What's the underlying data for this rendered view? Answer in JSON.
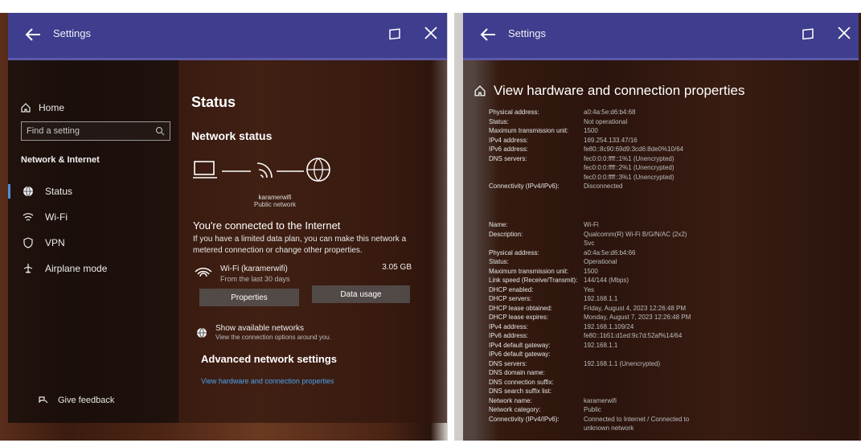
{
  "left": {
    "title": "Settings",
    "nav": {
      "home": "Home",
      "search_placeholder": "Find a setting",
      "section": "Network & Internet",
      "items": [
        {
          "label": "Status"
        },
        {
          "label": "Wi-Fi"
        },
        {
          "label": "VPN"
        },
        {
          "label": "Airplane mode"
        }
      ],
      "feedback": "Give feedback"
    },
    "content": {
      "title": "Status",
      "network_status": "Network status",
      "network_name": "karamerwifi",
      "network_type": "Public network",
      "connected": "You're connected to the Internet",
      "connected_desc": "If you have a limited data plan, you can make this network a metered connection or change other properties.",
      "wifi_name": "Wi-Fi (karamerwifi)",
      "wifi_sub": "From the last 30 days",
      "wifi_usage": "3.05 GB",
      "properties_btn": "Properties",
      "data_usage_btn": "Data usage",
      "show_networks": "Show available networks",
      "show_networks_desc": "View the connection options around you.",
      "advanced": "Advanced network settings",
      "advanced_link": "View hardware and connection properties"
    }
  },
  "right": {
    "title": "Settings",
    "header": "View hardware and connection properties",
    "group1": [
      {
        "k": "Physical address:",
        "v": "a0:4a:5e:d6:b4:68"
      },
      {
        "k": "Status:",
        "v": "Not operational"
      },
      {
        "k": "Maximum transmission unit:",
        "v": "1500"
      },
      {
        "k": "IPv4 address:",
        "v": "169.254.133.47/16"
      },
      {
        "k": "IPv6 address:",
        "v": "fe80::8c90:69d9:3cd6:8de0%10/64"
      },
      {
        "k": "DNS servers:",
        "v": "fec0:0:0:ffff::1%1 (Unencrypted)"
      },
      {
        "k": "",
        "v": "fec0:0:0:ffff::2%1 (Unencrypted)"
      },
      {
        "k": "",
        "v": "fec0:0:0:ffff::3%1 (Unencrypted)"
      },
      {
        "k": "Connectivity (IPv4/IPv6):",
        "v": "Disconnected"
      }
    ],
    "group2": [
      {
        "k": "Name:",
        "v": "Wi-Fi"
      },
      {
        "k": "Description:",
        "v": "Qualcomm(R) Wi-Fi B/G/N/AC (2x2)"
      },
      {
        "k": "",
        "v": "Svc"
      },
      {
        "k": "Physical address:",
        "v": "a0:4a:5e:d6:b4:66"
      },
      {
        "k": "Status:",
        "v": "Operational"
      },
      {
        "k": "Maximum transmission unit:",
        "v": "1500"
      },
      {
        "k": "Link speed (Receive/Transmit):",
        "v": "144/144 (Mbps)"
      },
      {
        "k": "DHCP enabled:",
        "v": "Yes"
      },
      {
        "k": "DHCP servers:",
        "v": "192.168.1.1"
      },
      {
        "k": "DHCP lease obtained:",
        "v": "Friday, August 4, 2023 12:26:48 PM"
      },
      {
        "k": "DHCP lease expires:",
        "v": "Monday, August 7, 2023 12:26:48 PM"
      },
      {
        "k": "IPv4 address:",
        "v": "192.168.1.109/24"
      },
      {
        "k": "IPv6 address:",
        "v": "fe80::1b51:d1ed:9c7d:52af%14/64"
      },
      {
        "k": "IPv4 default gateway:",
        "v": "192.168.1.1"
      },
      {
        "k": "IPv6 default gateway:",
        "v": ""
      },
      {
        "k": "DNS servers:",
        "v": "192.168.1.1 (Unencrypted)"
      },
      {
        "k": "DNS domain name:",
        "v": ""
      },
      {
        "k": "DNS connection suffix:",
        "v": ""
      },
      {
        "k": "DNS search suffix list:",
        "v": ""
      },
      {
        "k": "Network name:",
        "v": "karamerwifi"
      },
      {
        "k": "Network category:",
        "v": "Public"
      },
      {
        "k": "Connectivity (IPv4/IPv6):",
        "v": "Connected to Internet / Connected to"
      },
      {
        "k": "",
        "v": "unknown network"
      }
    ]
  }
}
